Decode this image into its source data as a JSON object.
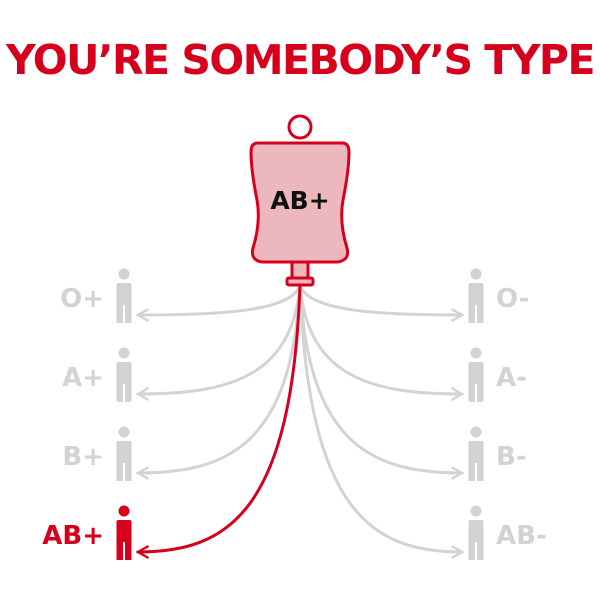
{
  "title": "YOU’RE SOMEBODY’S TYPE",
  "bag": {
    "label": "AB+"
  },
  "colors": {
    "accent": "#d6001c",
    "inactive": "#d3d3d3",
    "bag_fill": "#edb8bd",
    "white": "#ffffff"
  },
  "recipients": {
    "left": [
      {
        "label": "O+",
        "active": false
      },
      {
        "label": "A+",
        "active": false
      },
      {
        "label": "B+",
        "active": false
      },
      {
        "label": "AB+",
        "active": true
      }
    ],
    "right": [
      {
        "label": "O-",
        "active": false
      },
      {
        "label": "A-",
        "active": false
      },
      {
        "label": "B-",
        "active": false
      },
      {
        "label": "AB-",
        "active": false
      }
    ]
  }
}
